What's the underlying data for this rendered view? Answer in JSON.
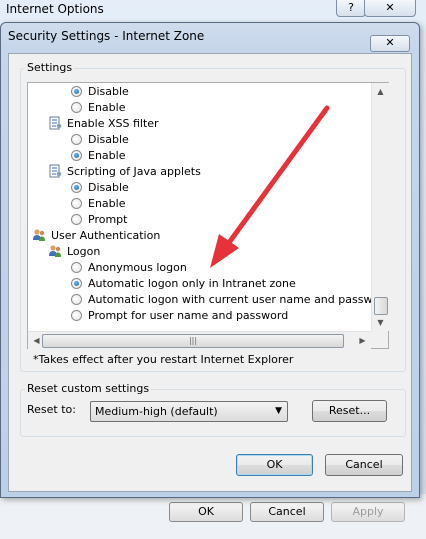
{
  "parent_window": {
    "title": "Internet Options",
    "help_label": "?",
    "close_label": "✕",
    "buttons": {
      "ok": "OK",
      "cancel": "Cancel",
      "apply": "Apply"
    }
  },
  "dialog": {
    "title": "Security Settings - Internet Zone",
    "close_label": "✕",
    "settings_group_label": "Settings",
    "settings_list": [
      {
        "type": "radio",
        "label": "Disable",
        "checked": true
      },
      {
        "type": "radio",
        "label": "Enable",
        "checked": false
      },
      {
        "type": "category",
        "label": "Enable XSS filter",
        "icon": "settings-doc-icon"
      },
      {
        "type": "radio",
        "label": "Disable",
        "checked": false
      },
      {
        "type": "radio",
        "label": "Enable",
        "checked": true
      },
      {
        "type": "category",
        "label": "Scripting of Java applets",
        "icon": "settings-doc-icon"
      },
      {
        "type": "radio",
        "label": "Disable",
        "checked": true
      },
      {
        "type": "radio",
        "label": "Enable",
        "checked": false
      },
      {
        "type": "radio",
        "label": "Prompt",
        "checked": false
      },
      {
        "type": "section",
        "label": "User Authentication",
        "icon": "users-icon"
      },
      {
        "type": "category",
        "label": "Logon",
        "icon": "users-icon"
      },
      {
        "type": "radio",
        "label": "Anonymous logon",
        "checked": false
      },
      {
        "type": "radio",
        "label": "Automatic logon only in Intranet zone",
        "checked": true
      },
      {
        "type": "radio",
        "label": "Automatic logon with current user name and password",
        "checked": false
      },
      {
        "type": "radio",
        "label": "Prompt for user name and password",
        "checked": false
      }
    ],
    "note": "*Takes effect after you restart Internet Explorer",
    "reset_group_label": "Reset custom settings",
    "reset_to_label": "Reset to:",
    "reset_select_value": "Medium-high (default)",
    "reset_button": "Reset...",
    "ok_button": "OK",
    "cancel_button": "Cancel"
  },
  "colors": {
    "annotation_arrow": "#e8323a",
    "radio_fill": "#1b5fb0"
  }
}
